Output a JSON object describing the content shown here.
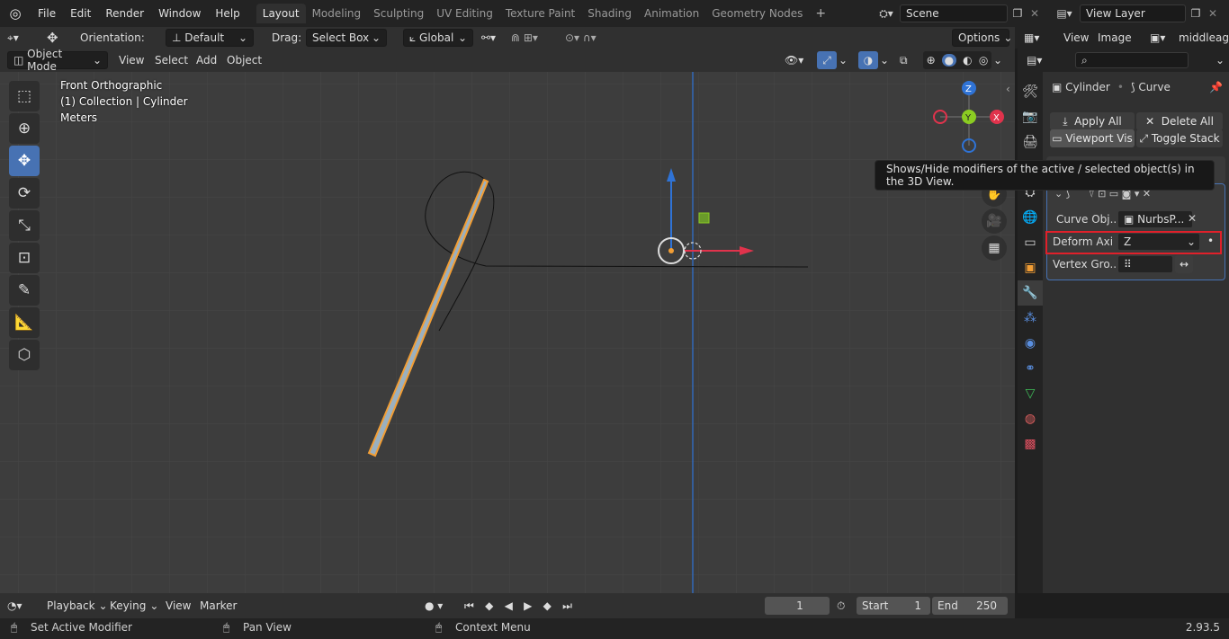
{
  "menu": {
    "file": "File",
    "edit": "Edit",
    "render": "Render",
    "window": "Window",
    "help": "Help"
  },
  "workspaces": [
    "Layout",
    "Modeling",
    "Sculpting",
    "UV Editing",
    "Texture Paint",
    "Shading",
    "Animation",
    "Geometry Nodes"
  ],
  "scene": {
    "name": "Scene",
    "view_layer": "View Layer"
  },
  "tool_header": {
    "orientation_label": "Orientation:",
    "orientation_value": "Default",
    "drag_label": "Drag:",
    "drag_value": "Select Box",
    "transform_orient": "Global",
    "options": "Options"
  },
  "viewport_header": {
    "mode": "Object Mode",
    "view": "View",
    "select": "Select",
    "add": "Add",
    "object": "Object"
  },
  "overlay_text": {
    "view_name": "Front Orthographic",
    "collection": "(1) Collection | Cylinder",
    "units": "Meters"
  },
  "image_editor": {
    "view": "View",
    "image": "Image",
    "name": "middleage"
  },
  "properties": {
    "object_name": "Cylinder",
    "modifier_name": "Curve",
    "apply_all": "Apply All",
    "delete_all": "Delete All",
    "viewport_vis": "Viewport Vis",
    "toggle_stack": "Toggle Stack",
    "curve_object_label": "Curve Obj...",
    "curve_object_value": "NurbsP...",
    "deform_axis_label": "Deform Axi",
    "deform_axis_value": "Z",
    "vertex_group_label": "Vertex Gro..."
  },
  "tooltip": "Shows/Hide modifiers of the active / selected object(s) in the 3D View.",
  "timeline": {
    "playback": "Playback",
    "keying": "Keying",
    "view": "View",
    "marker": "Marker",
    "current_frame": "1",
    "start_label": "Start",
    "start_value": "1",
    "end_label": "End",
    "end_value": "250"
  },
  "statusbar": {
    "left": "Set Active Modifier",
    "middle": "Pan View",
    "right": "Context Menu",
    "version": "2.93.5"
  },
  "gizmo": {
    "z": "Z",
    "y": "Y",
    "x": "X"
  },
  "colors": {
    "accent": "#4772b3",
    "highlight_box": "#e0202a",
    "orange": "#f29e35",
    "x_axis": "#e0334c",
    "y_axis": "#8bcc22",
    "z_axis": "#2f73d6"
  }
}
